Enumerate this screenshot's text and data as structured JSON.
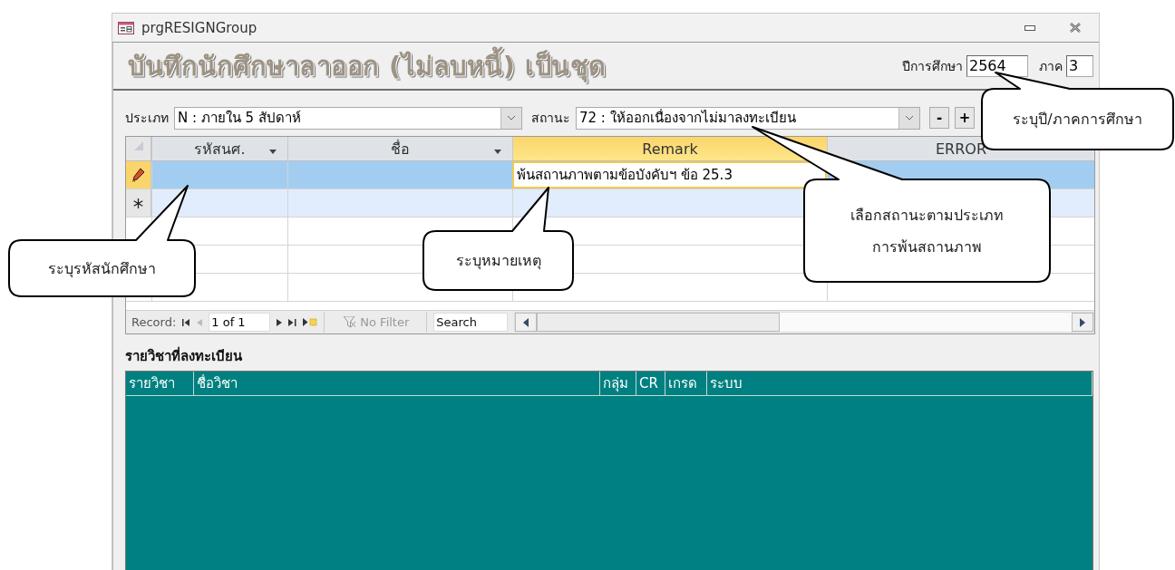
{
  "window": {
    "title": "prgRESIGNGroup"
  },
  "form_title": "บันทึกนักศึกษาลาออก (ไม่ลบหนี้) เป็นชุด",
  "academic_year": {
    "label": "ปีการศึกษา",
    "value": "2564"
  },
  "semester": {
    "label": "ภาค",
    "value": "3"
  },
  "type_filter": {
    "label": "ประเภท",
    "value": "N : ภายใน 5 สัปดาห์"
  },
  "status_filter": {
    "label": "สถานะ",
    "value": "72 : ให้ออกเนื่องจากไม่มาลงทะเบียน"
  },
  "buttons": [
    "-",
    "+"
  ],
  "datasheet": {
    "columns": [
      {
        "label": "รหัสนศ.",
        "dropdown": true,
        "selected": false
      },
      {
        "label": "ชื่อ",
        "dropdown": true,
        "selected": false
      },
      {
        "label": "Remark",
        "dropdown": false,
        "selected": true
      },
      {
        "label": "ERROR",
        "dropdown": false,
        "selected": false
      }
    ],
    "rows": [
      {
        "kind": "editing",
        "remark": "พ้นสถานภาพตามข้อบังคับฯ ข้อ 25.3"
      },
      {
        "kind": "new"
      }
    ]
  },
  "navigation": {
    "label": "Record:",
    "position": "1 of 1",
    "filter": "No Filter",
    "search": {
      "placeholder": "Search"
    }
  },
  "subform": {
    "title": "รายวิชาที่ลงทะเบียน",
    "columns": [
      "รายวิชา",
      "ชื่อวิชา",
      "กลุ่ม",
      "CR",
      "เกรด",
      "ระบบ"
    ]
  },
  "callouts": [
    {
      "lines": [
        "ระบุปี/ภาคการศึกษา"
      ]
    },
    {
      "lines": [
        "เลือกสถานะตามประเภท",
        "การพ้นสถานภาพ"
      ]
    },
    {
      "lines": [
        "ระบุหมายเหตุ"
      ]
    },
    {
      "lines": [
        "ระบุรหัสนักศึกษา"
      ]
    }
  ]
}
